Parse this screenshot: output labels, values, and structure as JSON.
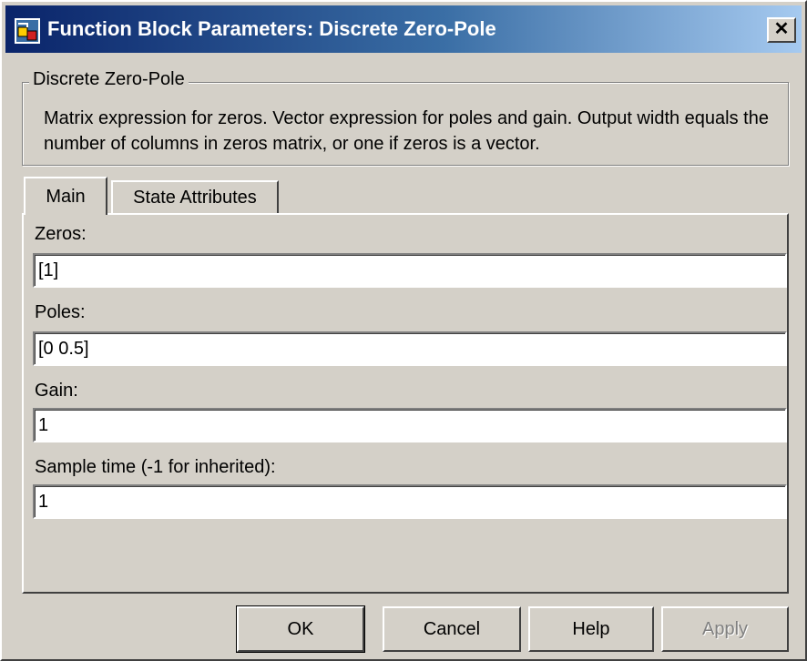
{
  "window": {
    "title": "Function Block Parameters: Discrete Zero-Pole",
    "close_label": "✕"
  },
  "group": {
    "legend": "Discrete Zero-Pole",
    "description": "Matrix expression for zeros.  Vector expression for poles and gain. Output width equals the number of columns in zeros matrix, or one if zeros is a vector."
  },
  "tabs": [
    {
      "label": "Main",
      "active": true
    },
    {
      "label": "State Attributes",
      "active": false
    }
  ],
  "fields": {
    "zeros": {
      "label": "Zeros:",
      "value": "[1]"
    },
    "poles": {
      "label": "Poles:",
      "value": "[0 0.5]"
    },
    "gain": {
      "label": "Gain:",
      "value": "1"
    },
    "sample_time": {
      "label": "Sample time (-1 for inherited):",
      "value": "1"
    }
  },
  "buttons": {
    "ok": "OK",
    "cancel": "Cancel",
    "help": "Help",
    "apply": "Apply"
  },
  "icons": {
    "title_icon": "simulink-block-icon",
    "close_icon": "close-icon"
  },
  "colors": {
    "titlebar_start": "#0a246a",
    "titlebar_end": "#a6caf0",
    "face": "#d4d0c8",
    "disabled_text": "#808080"
  }
}
